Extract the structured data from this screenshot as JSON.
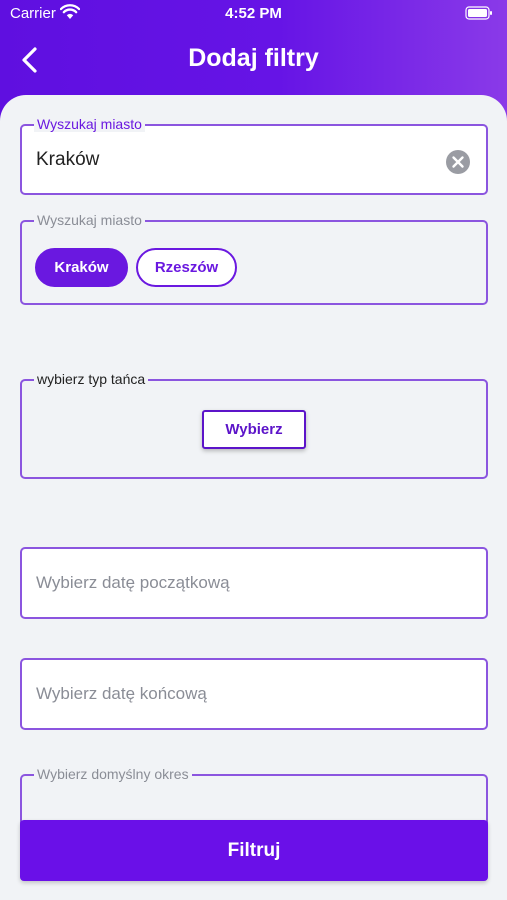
{
  "status_bar": {
    "carrier": "Carrier",
    "time": "4:52 PM"
  },
  "header": {
    "title": "Dodaj filtry"
  },
  "city_search": {
    "legend": "Wyszukaj miasto",
    "value": "Kraków"
  },
  "city_chips": {
    "legend": "Wyszukaj miasto",
    "chips": [
      "Kraków",
      "Rzeszów"
    ]
  },
  "dance_type": {
    "legend": "wybierz typ tańca",
    "button_label": "Wybierz"
  },
  "start_date": {
    "placeholder": "Wybierz datę początkową"
  },
  "end_date": {
    "placeholder": "Wybierz datę końcową"
  },
  "default_period": {
    "legend": "Wybierz domyślny okres"
  },
  "filter_button": {
    "label": "Filtruj"
  },
  "colors": {
    "primary": "#6a18e0",
    "background": "#f1f3f6",
    "border": "#8b55df"
  }
}
